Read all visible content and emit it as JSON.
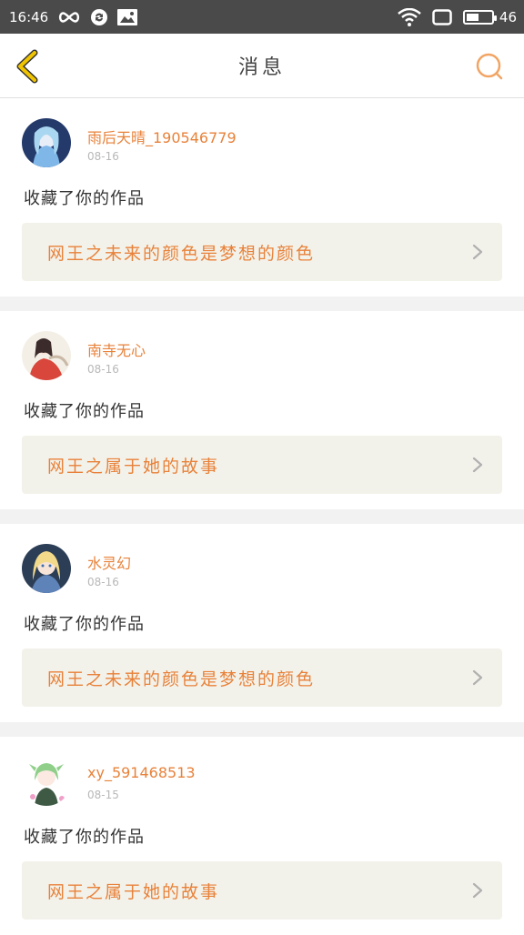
{
  "status_bar": {
    "time": "16:46",
    "battery_level": "46",
    "icons": [
      "infinity-icon",
      "sync-icon",
      "image-icon",
      "wifi-icon",
      "screen-icon",
      "battery-icon"
    ]
  },
  "header": {
    "title": "消息",
    "back_icon": "chevron-left-icon",
    "search_icon": "search-icon"
  },
  "colors": {
    "accent": "#e8823a",
    "back_arrow": "#e6b800",
    "status_bar": "#4a4a4a",
    "link_bg": "#f3f2ea"
  },
  "messages": [
    {
      "username": "雨后天晴_190546779",
      "date": "08-16",
      "action": "收藏了你的作品",
      "work_title": "网王之未来的颜色是梦想的颜色"
    },
    {
      "username": "南寺无心",
      "date": "08-16",
      "action": "收藏了你的作品",
      "work_title": "网王之属于她的故事"
    },
    {
      "username": "水灵幻",
      "date": "08-16",
      "action": "收藏了你的作品",
      "work_title": "网王之未来的颜色是梦想的颜色"
    },
    {
      "username": "xy_591468513",
      "date": "08-15",
      "action": "收藏了你的作品",
      "work_title": "网王之属于她的故事"
    }
  ]
}
